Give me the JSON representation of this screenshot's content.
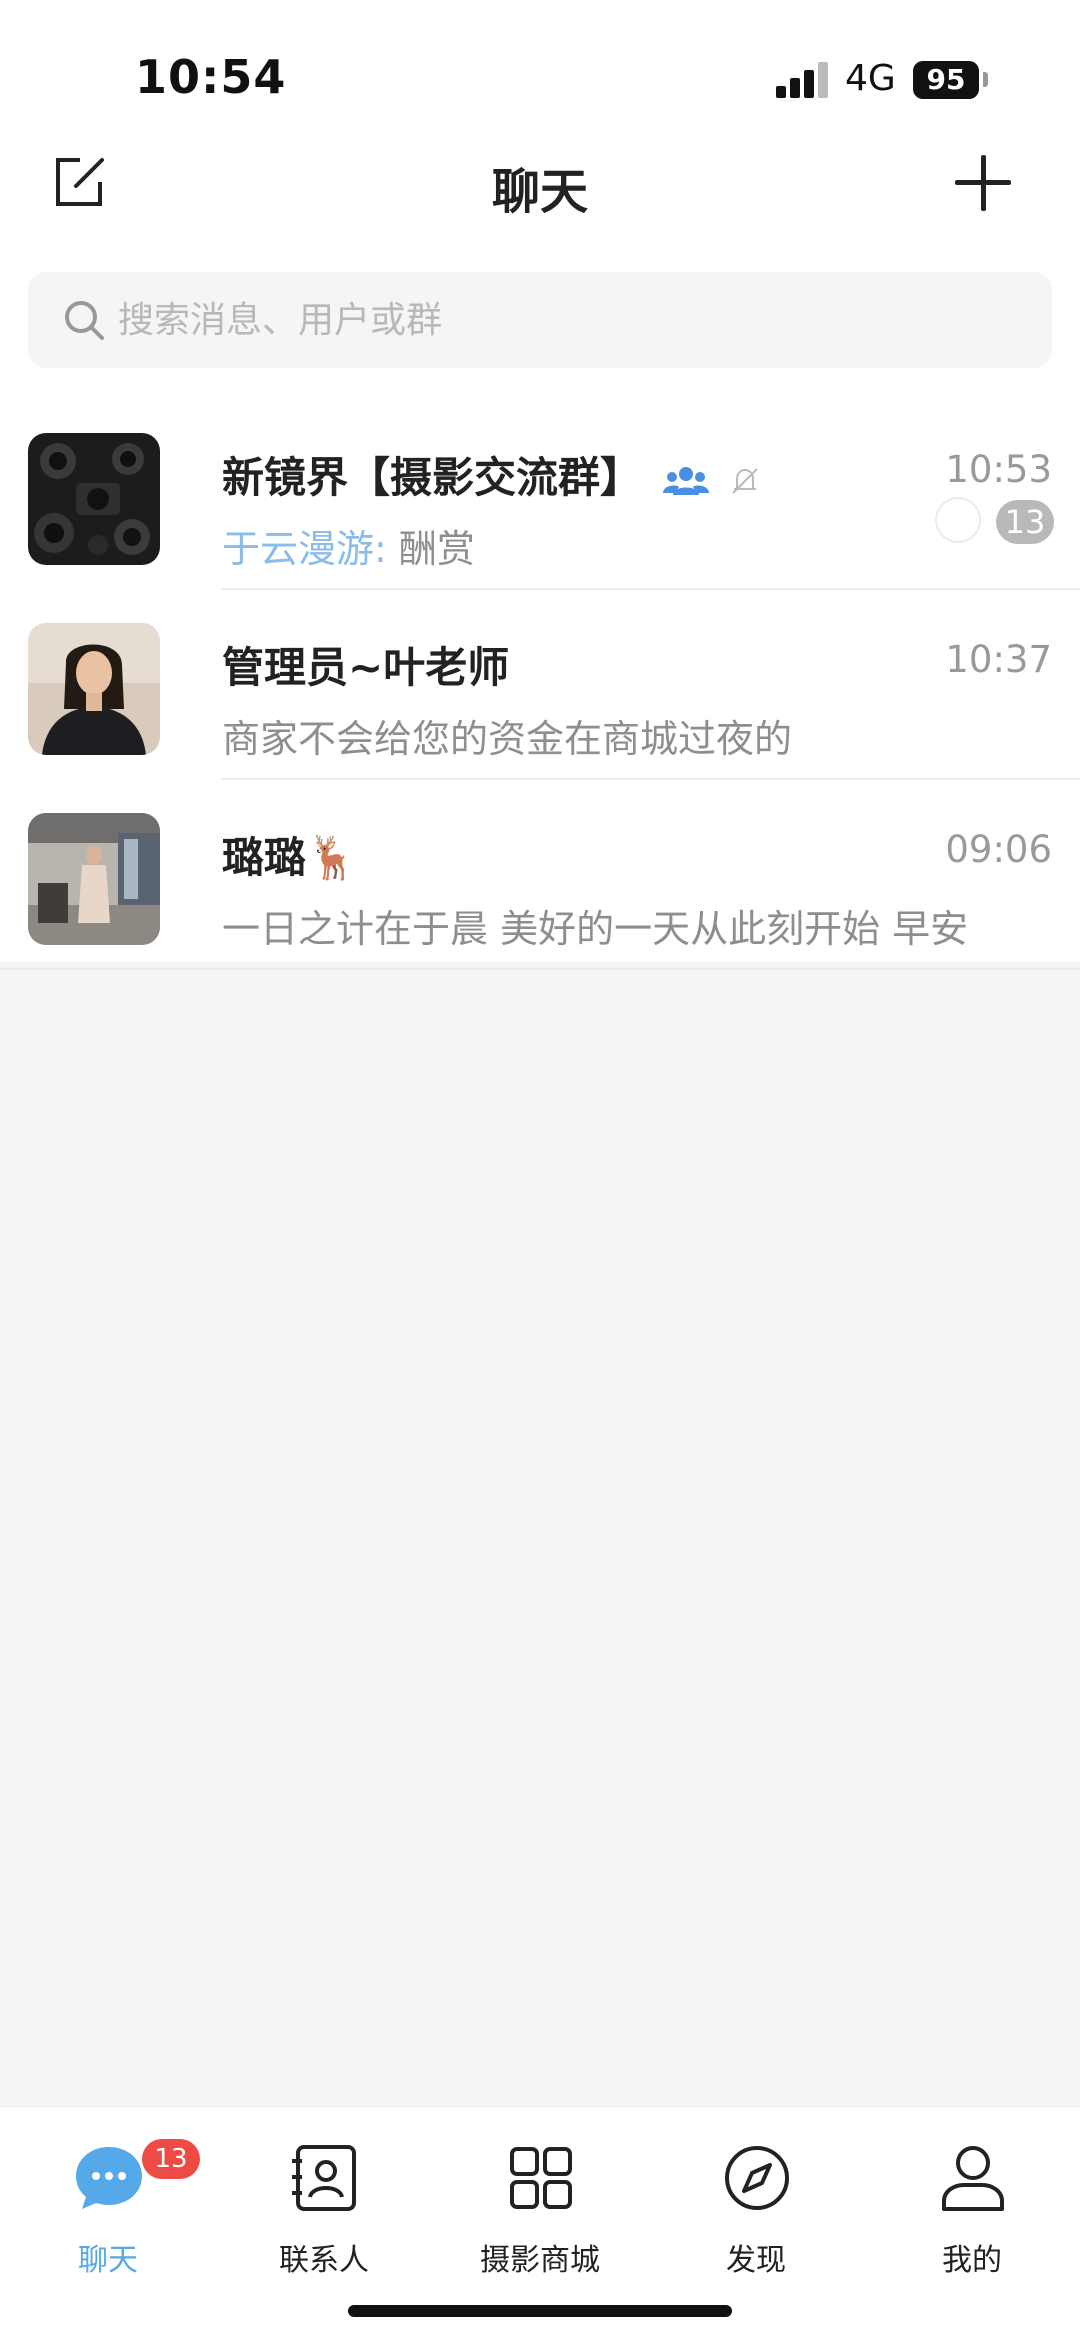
{
  "status_bar": {
    "time": "10:54",
    "network": "4G",
    "battery": "95"
  },
  "header": {
    "title": "聊天",
    "compose_icon": "compose-icon",
    "add_icon": "plus-icon"
  },
  "search": {
    "placeholder": "搜索消息、用户或群",
    "icon": "search-icon"
  },
  "chats": [
    {
      "name": "新镜界【摄影交流群】",
      "time": "10:53",
      "sender": "于云漫游:",
      "preview": "酬赏",
      "unread": "13",
      "is_group": true,
      "muted": true
    },
    {
      "name": "管理员~叶老师",
      "time": "10:37",
      "preview": "商家不会给您的资金在商城过夜的"
    },
    {
      "name": "璐璐🦌",
      "time": "09:06",
      "preview": "一日之计在于晨 美好的一天从此刻开始 早安"
    }
  ],
  "tabbar": {
    "tabs": [
      {
        "label": "聊天",
        "icon": "chat-bubble-icon",
        "active": true,
        "badge": "13"
      },
      {
        "label": "联系人",
        "icon": "contacts-icon"
      },
      {
        "label": "摄影商城",
        "icon": "grid-icon"
      },
      {
        "label": "发现",
        "icon": "compass-icon"
      },
      {
        "label": "我的",
        "icon": "person-icon"
      }
    ]
  },
  "colors": {
    "accent": "#55a9e8",
    "badge": "#ee4b44",
    "sender": "#8bbbe8",
    "background": "#f4f5f7"
  }
}
